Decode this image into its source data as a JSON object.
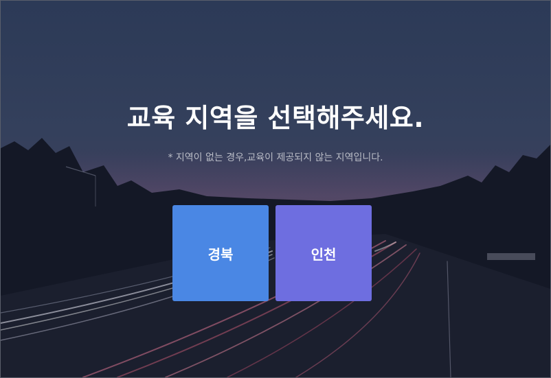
{
  "page": {
    "title": "교육 지역을 선택해주세요.",
    "subtitle": "* 지역이 없는 경우,교육이 제공되지 않는 지역입니다."
  },
  "regions": [
    {
      "label": "경북",
      "color": "#4a87e4"
    },
    {
      "label": "인천",
      "color": "#6e6ee0"
    }
  ],
  "theme": {
    "title_color": "#ffffff",
    "subtitle_color": "#b9bcc6",
    "background": "#1c2233"
  }
}
